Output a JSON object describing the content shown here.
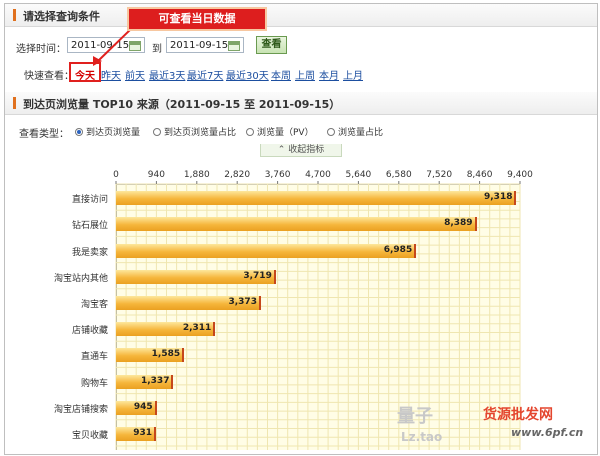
{
  "query_section": {
    "title": "请选择查询条件"
  },
  "filters": {
    "time_label": "选择时间：",
    "start_date": "2011-09-15",
    "to_label": "到",
    "end_date": "2011-09-15",
    "query_button": "查看",
    "quick_label": "快速查看：",
    "quick_links": [
      "今天",
      "昨天",
      "前天",
      "最近3天",
      "最近7天",
      "最近30天",
      "本周",
      "上周",
      "本月",
      "上月"
    ]
  },
  "annotation": {
    "callout_text": "可查看当日数据"
  },
  "report_section": {
    "title": "到达页浏览量  TOP10 来源（2011-09-15 至  2011-09-15）"
  },
  "view_type": {
    "label": "查看类型：",
    "options": [
      "到达页浏览量",
      "到达页浏览量占比",
      "浏览量（PV）",
      "浏览量占比"
    ],
    "selected_index": 0
  },
  "collapse_tab": {
    "label": "收起指标"
  },
  "chart_data": {
    "type": "bar",
    "orientation": "horizontal",
    "categories": [
      "直接访问",
      "钻石展位",
      "我是卖家",
      "淘宝站内其他",
      "淘宝客",
      "店铺收藏",
      "直通车",
      "购物车",
      "淘宝店铺搜索",
      "宝贝收藏"
    ],
    "values": [
      9318,
      8389,
      6985,
      3719,
      3373,
      2311,
      1585,
      1337,
      945,
      931
    ],
    "value_labels": [
      "9,318",
      "8,389",
      "6,985",
      "3,719",
      "3,373",
      "2,311",
      "1,585",
      "1,337",
      "945",
      "931"
    ],
    "x_ticks": [
      "0",
      "940",
      "1,880",
      "2,820",
      "3,760",
      "4,700",
      "5,640",
      "6,580",
      "7,520",
      "8,460",
      "9,400"
    ],
    "xlim": [
      0,
      9400
    ],
    "grid": true,
    "colors": {
      "bar": "#f6b63c",
      "bar_edge": "#c5471c",
      "plot_bg": "#fffde6",
      "grid": "#efe6b0"
    }
  },
  "watermarks": {
    "site": "量子",
    "url": "Lz.tao",
    "badge": "货源批发网",
    "domain": "www.6pf.cn"
  }
}
